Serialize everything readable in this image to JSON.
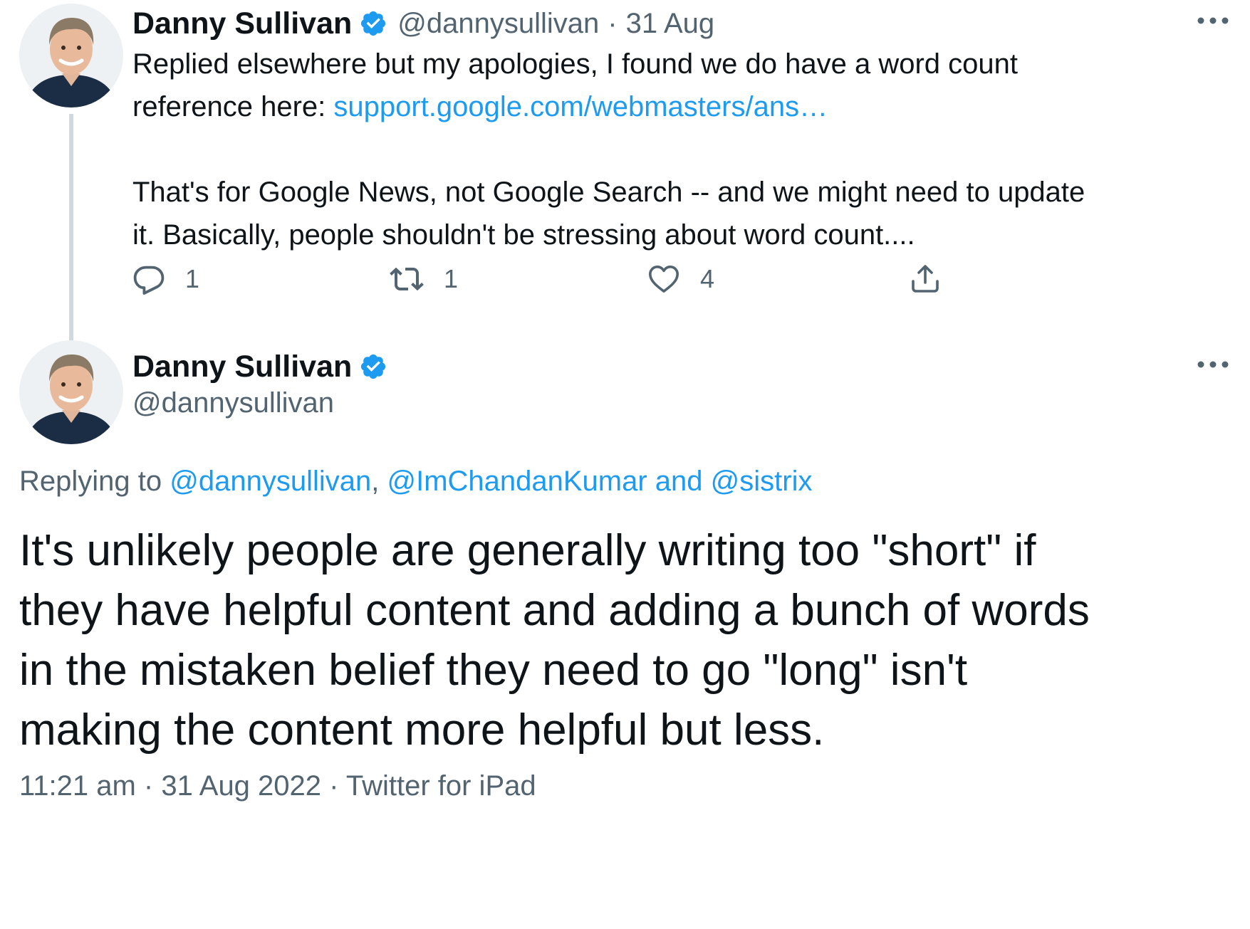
{
  "tweet1": {
    "author_name": "Danny Sullivan",
    "handle": "@dannysullivan",
    "separator": "·",
    "date": "31 Aug",
    "text_line1": "Replied elsewhere but my apologies, I found we do have a word count",
    "text_line2_prefix": "reference here: ",
    "link_text": "support.google.com/webmasters/ans…",
    "paragraph2_line1": "That's for Google News, not Google Search -- and we might need to update",
    "paragraph2_line2": "it. Basically, people shouldn't be stressing about word count....",
    "reply_count": "1",
    "retweet_count": "1",
    "like_count": "4",
    "more_icon": "more-horizontal-icon",
    "verified_icon": "verified-badge-icon"
  },
  "tweet2": {
    "author_name": "Danny Sullivan",
    "handle": "@dannysullivan",
    "replying_prefix": "Replying to ",
    "mention1": "@dannysullivan",
    "comma": ", ",
    "mention2": "@ImChandanKumar",
    "and": " and ",
    "mention3": "@sistrix",
    "text_line1": "It's unlikely people are generally writing too \"short\" if",
    "text_line2": "they have helpful content and adding a bunch of words",
    "text_line3": "in the mistaken belief they need to go \"long\" isn't",
    "text_line4": "making the content more helpful but less.",
    "time": "11:21 am",
    "separator": " · ",
    "full_date": "31 Aug 2022",
    "source": "Twitter for iPad"
  },
  "colors": {
    "text": "#0f1419",
    "secondary": "#536471",
    "link": "#1d9bf0",
    "verified": "#1d9bf0",
    "thread_line": "#cfd9de"
  }
}
